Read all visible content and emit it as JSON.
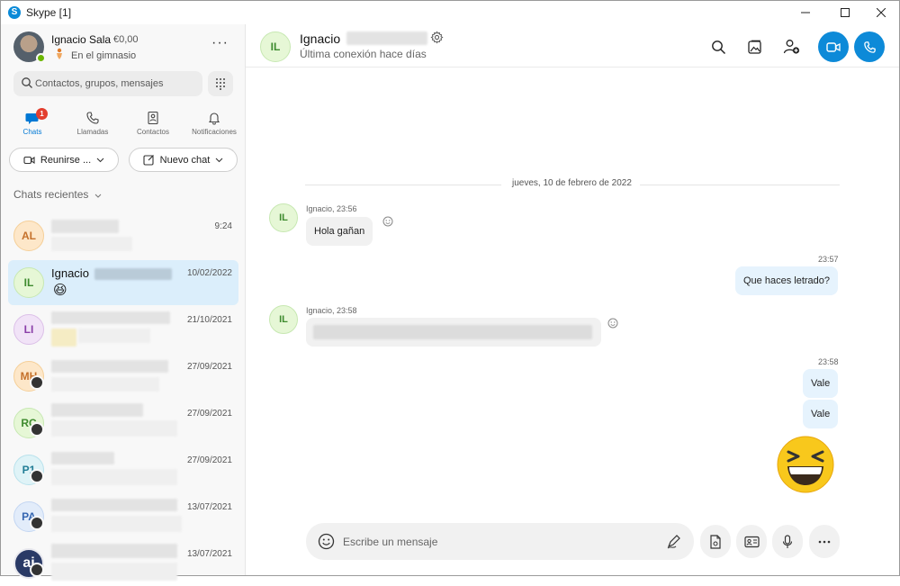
{
  "window": {
    "title": "Skype [1]",
    "app_icon": "S"
  },
  "profile": {
    "name": "Ignacio Sala",
    "credit": "€0,00",
    "status": "En el gimnasio",
    "more": "···"
  },
  "search": {
    "placeholder": "Contactos, grupos, mensajes"
  },
  "nav": [
    {
      "label": "Chats",
      "badge": "1",
      "active": true
    },
    {
      "label": "Llamadas"
    },
    {
      "label": "Contactos"
    },
    {
      "label": "Notificaciones"
    }
  ],
  "actions": {
    "meet": "Reunirse ...",
    "new_chat": "Nuevo chat"
  },
  "recent": {
    "header": "Chats recientes"
  },
  "chats": [
    {
      "initials": "AL",
      "name": "",
      "time": "9:24"
    },
    {
      "initials": "IL",
      "name": "Ignacio",
      "time": "10/02/2022",
      "preview_emoji": "😆"
    },
    {
      "initials": "LI",
      "name": "",
      "time": "21/10/2021"
    },
    {
      "initials": "MH",
      "name": "",
      "time": "27/09/2021"
    },
    {
      "initials": "RC",
      "name": "",
      "time": "27/09/2021"
    },
    {
      "initials": "P1",
      "name": "",
      "time": "27/09/2021"
    },
    {
      "initials": "PA",
      "name": "",
      "time": "13/07/2021"
    },
    {
      "initials": "aj",
      "name": "",
      "time": "13/07/2021"
    }
  ],
  "conversation": {
    "initials": "IL",
    "name": "Ignacio",
    "last_seen": "Última conexión hace días",
    "date_separator": "jueves, 10 de febrero de 2022",
    "messages": [
      {
        "from": "Ignacio",
        "meta": "Ignacio, 23:56",
        "text": "Hola gañan"
      },
      {
        "from": "me",
        "meta": "23:57",
        "text": "Que haces letrado?"
      },
      {
        "from": "Ignacio",
        "meta": "Ignacio, 23:58",
        "text": ""
      },
      {
        "from": "me",
        "meta": "23:58",
        "text": "Vale"
      },
      {
        "from": "me",
        "meta": "",
        "text": "Vale"
      }
    ],
    "composer_placeholder": "Escribe un mensaje"
  },
  "colors": {
    "accent": "#0d8ad8",
    "badge": "#e33e2e",
    "selected_row": "#dbeefb",
    "outgoing_bubble": "#e6f3fd"
  }
}
